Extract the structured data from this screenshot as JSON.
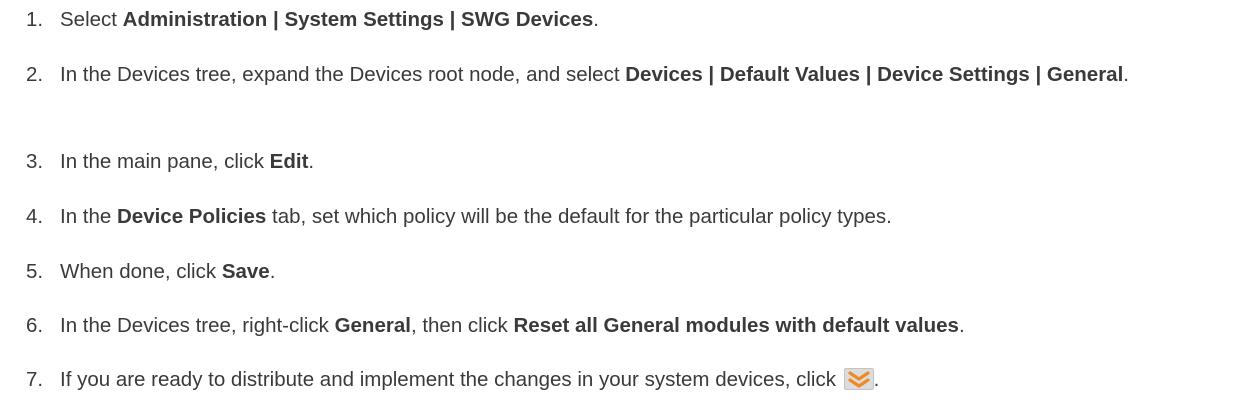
{
  "steps": [
    {
      "number": "1.",
      "parts": [
        {
          "text": "Select "
        },
        {
          "text": "Administration | System Settings | SWG Devices",
          "bold": true
        },
        {
          "text": "."
        }
      ]
    },
    {
      "number": "2.",
      "parts": [
        {
          "text": "In the Devices tree, expand the Devices root node, and select "
        },
        {
          "text": "Devices | Default Values | Device Settings | General",
          "bold": true
        },
        {
          "text": "."
        }
      ]
    },
    {
      "number": "3.",
      "parts": [
        {
          "text": "In the main pane, click "
        },
        {
          "text": "Edit",
          "bold": true
        },
        {
          "text": "."
        }
      ]
    },
    {
      "number": "4.",
      "parts": [
        {
          "text": "In the "
        },
        {
          "text": "Device Policies",
          "bold": true
        },
        {
          "text": " tab, set which policy will be the default for the particular policy types."
        }
      ]
    },
    {
      "number": "5.",
      "parts": [
        {
          "text": "When done, click "
        },
        {
          "text": "Save",
          "bold": true
        },
        {
          "text": "."
        }
      ]
    },
    {
      "number": "6.",
      "parts": [
        {
          "text": "In the Devices tree, right-click "
        },
        {
          "text": "General",
          "bold": true
        },
        {
          "text": ", then click "
        },
        {
          "text": "Reset all General modules with default values",
          "bold": true
        },
        {
          "text": "."
        }
      ]
    },
    {
      "number": "7.",
      "parts": [
        {
          "text": "If you are ready to distribute and implement the changes in your system devices, click "
        },
        {
          "icon": "deploy-changes-icon"
        },
        {
          "text": "."
        }
      ]
    }
  ],
  "colors": {
    "text": "#3a3a3a",
    "icon_orange": "#f08a24",
    "icon_bg": "#dcdcdc"
  }
}
